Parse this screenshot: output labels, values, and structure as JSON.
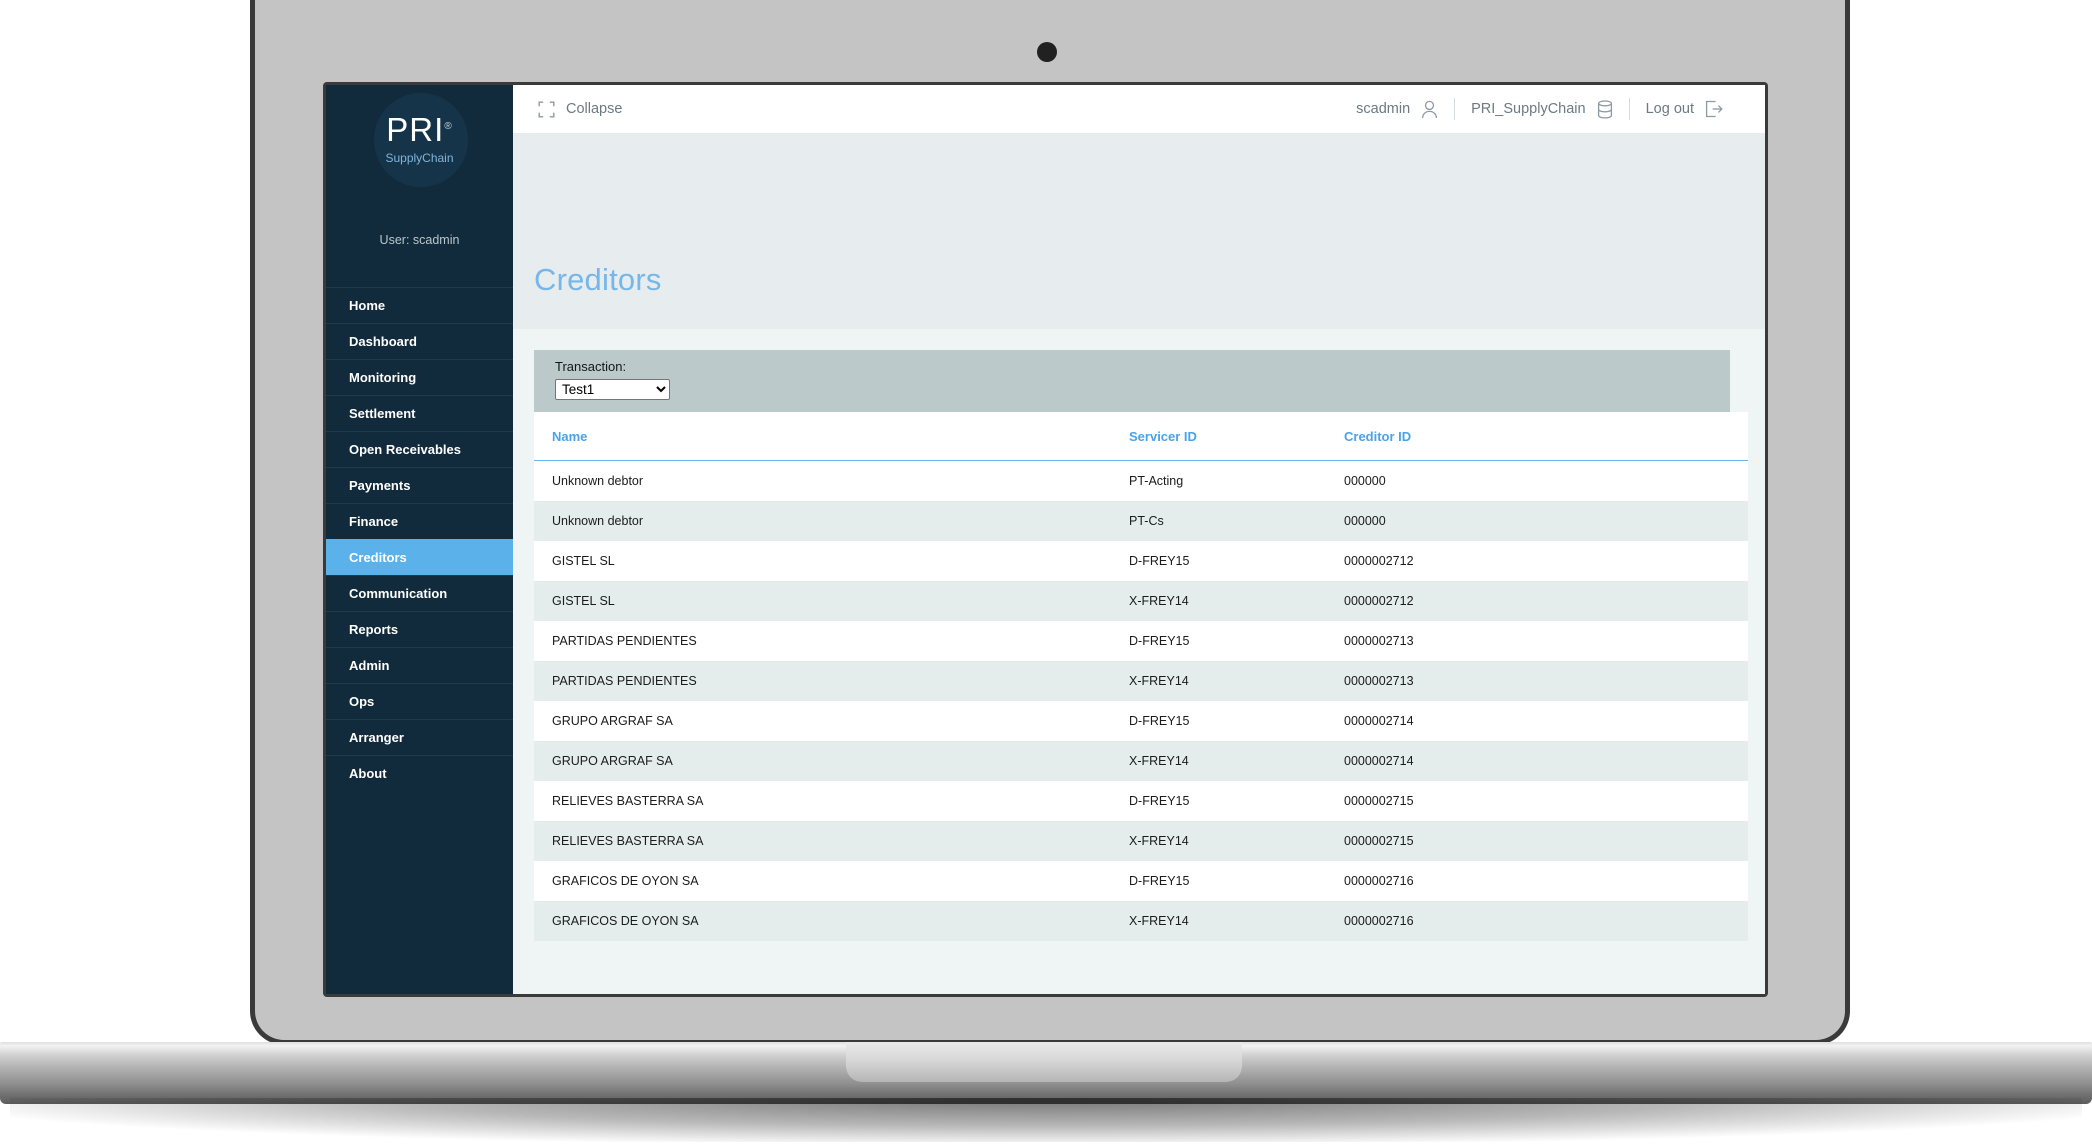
{
  "device": {
    "type": "laptop-mockup",
    "camera_icon": "camera-dot"
  },
  "sidebar": {
    "brand": {
      "logo_text": "PRI",
      "registered_mark": "®",
      "subtitle": "SupplyChain",
      "user_label": "User: scadmin"
    },
    "active_item": "Creditors",
    "items": [
      {
        "label": "Home",
        "active": false
      },
      {
        "label": "Dashboard",
        "active": false
      },
      {
        "label": "Monitoring",
        "active": false
      },
      {
        "label": "Settlement",
        "active": false
      },
      {
        "label": "Open Receivables",
        "active": false
      },
      {
        "label": "Payments",
        "active": false
      },
      {
        "label": "Finance",
        "active": false
      },
      {
        "label": "Creditors",
        "active": true
      },
      {
        "label": "Communication",
        "active": false
      },
      {
        "label": "Reports",
        "active": false
      },
      {
        "label": "Admin",
        "active": false
      },
      {
        "label": "Ops",
        "active": false
      },
      {
        "label": "Arranger",
        "active": false
      },
      {
        "label": "About",
        "active": false
      }
    ]
  },
  "topbar": {
    "collapse_label": "Collapse",
    "collapse_icon": "collapse-corners-icon",
    "user_name": "scadmin",
    "user_icon": "person-icon",
    "database_name": "PRI_SupplyChain",
    "database_icon": "database-icon",
    "logout_label": "Log out",
    "logout_icon": "logout-arrow-icon"
  },
  "page": {
    "title": "Creditors"
  },
  "filter": {
    "transaction_label": "Transaction:",
    "transaction_value": "Test1",
    "transaction_options": [
      "Test1"
    ]
  },
  "table": {
    "columns": [
      {
        "key": "name",
        "label": "Name"
      },
      {
        "key": "servicer_id",
        "label": "Servicer ID"
      },
      {
        "key": "creditor_id",
        "label": "Creditor ID"
      }
    ],
    "rows": [
      {
        "name": "Unknown debtor",
        "servicer_id": "PT-Acting",
        "creditor_id": "000000"
      },
      {
        "name": "Unknown debtor",
        "servicer_id": "PT-Cs",
        "creditor_id": "000000"
      },
      {
        "name": "GISTEL SL",
        "servicer_id": "D-FREY15",
        "creditor_id": "0000002712"
      },
      {
        "name": "GISTEL SL",
        "servicer_id": "X-FREY14",
        "creditor_id": "0000002712"
      },
      {
        "name": "PARTIDAS PENDIENTES",
        "servicer_id": "D-FREY15",
        "creditor_id": "0000002713"
      },
      {
        "name": "PARTIDAS PENDIENTES",
        "servicer_id": "X-FREY14",
        "creditor_id": "0000002713"
      },
      {
        "name": "GRUPO ARGRAF SA",
        "servicer_id": "D-FREY15",
        "creditor_id": "0000002714"
      },
      {
        "name": "GRUPO ARGRAF SA",
        "servicer_id": "X-FREY14",
        "creditor_id": "0000002714"
      },
      {
        "name": "RELIEVES BASTERRA SA",
        "servicer_id": "D-FREY15",
        "creditor_id": "0000002715"
      },
      {
        "name": "RELIEVES BASTERRA SA",
        "servicer_id": "X-FREY14",
        "creditor_id": "0000002715"
      },
      {
        "name": "GRAFICOS DE OYON SA",
        "servicer_id": "D-FREY15",
        "creditor_id": "0000002716"
      },
      {
        "name": "GRAFICOS DE OYON SA",
        "servicer_id": "X-FREY14",
        "creditor_id": "0000002716"
      }
    ]
  },
  "colors": {
    "sidebar_bg": "#112b3c",
    "sidebar_active": "#5bb1ea",
    "page_header_bg": "#e7edee",
    "content_bg": "#eff4f4",
    "filter_bar_bg": "#bcc9cb",
    "accent_blue": "#4aa3e8",
    "title_blue": "#77b6e8",
    "row_alt_bg": "#e5ecec"
  }
}
